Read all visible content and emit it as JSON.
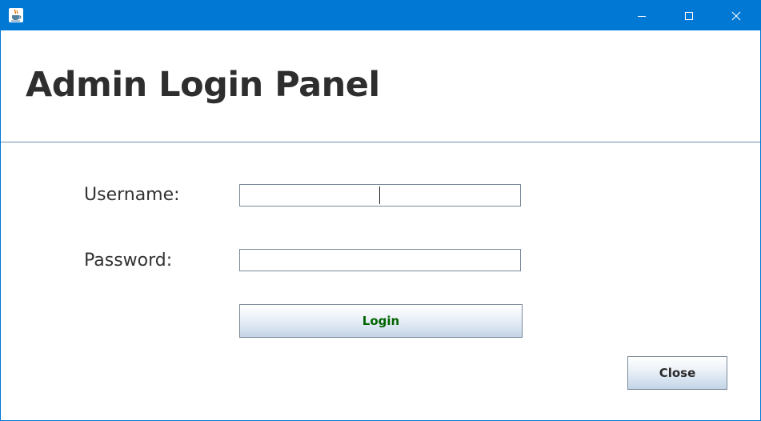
{
  "window": {
    "accent_color": "#0078d4",
    "app_icon": "java-coffee-cup-icon",
    "controls": {
      "minimize_icon": "minimize-icon",
      "maximize_icon": "maximize-icon",
      "close_icon": "close-icon"
    }
  },
  "header": {
    "title": "Admin Login Panel"
  },
  "form": {
    "username_label": "Username:",
    "username_value": "",
    "password_label": "Password:",
    "password_value": "",
    "login_label": "Login",
    "login_color": "#006400",
    "close_label": "Close"
  }
}
